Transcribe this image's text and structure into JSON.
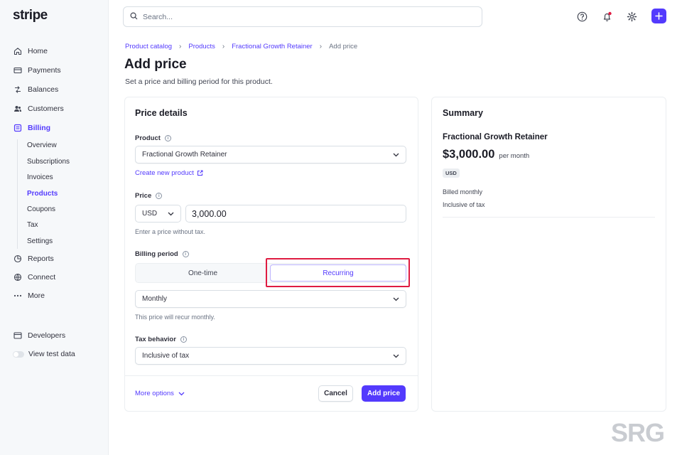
{
  "sidebar": {
    "logo": "stripe",
    "items": [
      {
        "label": "Home",
        "icon": "home-icon"
      },
      {
        "label": "Payments",
        "icon": "payments-icon"
      },
      {
        "label": "Balances",
        "icon": "balances-icon"
      },
      {
        "label": "Customers",
        "icon": "customers-icon"
      },
      {
        "label": "Billing",
        "icon": "billing-icon"
      },
      {
        "label": "Reports",
        "icon": "reports-icon"
      },
      {
        "label": "Connect",
        "icon": "connect-icon"
      },
      {
        "label": "More",
        "icon": "more-icon"
      },
      {
        "label": "Developers",
        "icon": "developers-icon"
      },
      {
        "label": "View test data",
        "icon": "toggle"
      }
    ],
    "billing_sub": [
      "Overview",
      "Subscriptions",
      "Invoices",
      "Products",
      "Coupons",
      "Tax",
      "Settings"
    ]
  },
  "search": {
    "placeholder": "Search..."
  },
  "breadcrumb": [
    "Product catalog",
    "Products",
    "Fractional Growth Retainer",
    "Add price"
  ],
  "page": {
    "title": "Add price",
    "subtitle": "Set a price and billing period for this product."
  },
  "form": {
    "title": "Price details",
    "product_label": "Product",
    "product_value": "Fractional Growth Retainer",
    "create_link": "Create new product",
    "price_label": "Price",
    "currency": "USD",
    "amount": "3,000.00",
    "price_help": "Enter a price without tax.",
    "billing_label": "Billing period",
    "one_time": "One-time",
    "recurring": "Recurring",
    "interval": "Monthly",
    "interval_help": "This price will recur monthly.",
    "tax_label": "Tax behavior",
    "tax_value": "Inclusive of tax",
    "more_options": "More options",
    "cancel": "Cancel",
    "submit": "Add price"
  },
  "summary": {
    "title": "Summary",
    "product": "Fractional Growth Retainer",
    "price": "$3,000.00",
    "per": "per month",
    "currency_badge": "USD",
    "billed": "Billed monthly",
    "tax": "Inclusive of tax"
  },
  "watermark": "SRG",
  "colors": {
    "accent": "#533afd",
    "highlight": "#df1b41"
  }
}
